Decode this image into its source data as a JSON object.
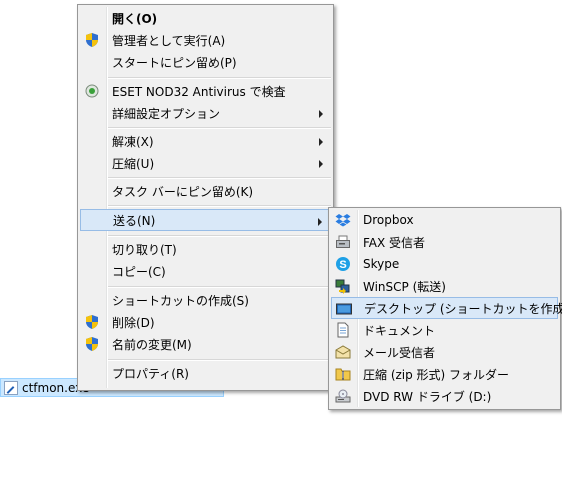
{
  "file": {
    "name": "ctfmon.exe"
  },
  "main_menu": {
    "items": [
      {
        "label": "開く(O)"
      },
      {
        "label": "管理者として実行(A)"
      },
      {
        "label": "スタートにピン留め(P)"
      },
      {
        "label": "ESET NOD32 Antivirus で検査"
      },
      {
        "label": "詳細設定オプション"
      },
      {
        "label": "解凍(X)"
      },
      {
        "label": "圧縮(U)"
      },
      {
        "label": "タスク バーにピン留め(K)"
      },
      {
        "label": "送る(N)"
      },
      {
        "label": "切り取り(T)"
      },
      {
        "label": "コピー(C)"
      },
      {
        "label": "ショートカットの作成(S)"
      },
      {
        "label": "削除(D)"
      },
      {
        "label": "名前の変更(M)"
      },
      {
        "label": "プロパティ(R)"
      }
    ]
  },
  "send_to_menu": {
    "items": [
      {
        "label": "Dropbox",
        "icon": "dropbox-icon"
      },
      {
        "label": "FAX 受信者",
        "icon": "fax-icon"
      },
      {
        "label": "Skype",
        "icon": "skype-icon"
      },
      {
        "label": "WinSCP (転送)",
        "icon": "winscp-icon"
      },
      {
        "label": "デスクトップ (ショートカットを作成)",
        "icon": "desktop-icon"
      },
      {
        "label": "ドキュメント",
        "icon": "documents-icon"
      },
      {
        "label": "メール受信者",
        "icon": "mail-icon"
      },
      {
        "label": "圧縮 (zip 形式) フォルダー",
        "icon": "zip-folder-icon"
      },
      {
        "label": "DVD RW ドライブ (D:)",
        "icon": "dvd-drive-icon"
      }
    ]
  },
  "colors": {
    "highlight": "#d9e8f8",
    "highlight_border": "#97bce6",
    "menu_bg": "#f0f0f0",
    "selection": "#cce8ff"
  }
}
